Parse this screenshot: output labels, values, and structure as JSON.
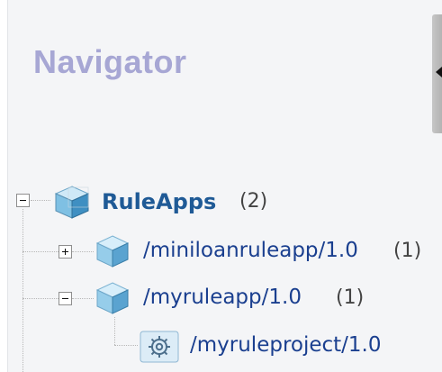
{
  "panel": {
    "title": "Navigator"
  },
  "tree": {
    "root": {
      "label": "RuleApps",
      "count": "(2)",
      "icon": "cube-icon",
      "expanded": true
    },
    "children": [
      {
        "label": "/miniloanruleapp/1.0",
        "count": "(1)",
        "icon": "cube-icon",
        "expanded": false
      },
      {
        "label": "/myruleapp/1.0",
        "count": "(1)",
        "icon": "cube-icon",
        "expanded": true
      }
    ],
    "grandchildren": [
      {
        "label": "/myruleproject/1.0",
        "icon": "gear-icon"
      }
    ]
  },
  "colors": {
    "title": "#a7a7d4",
    "link": "#1a3f8f",
    "root": "#1f5a96",
    "count": "#444444",
    "background": "#f4f5f7"
  }
}
